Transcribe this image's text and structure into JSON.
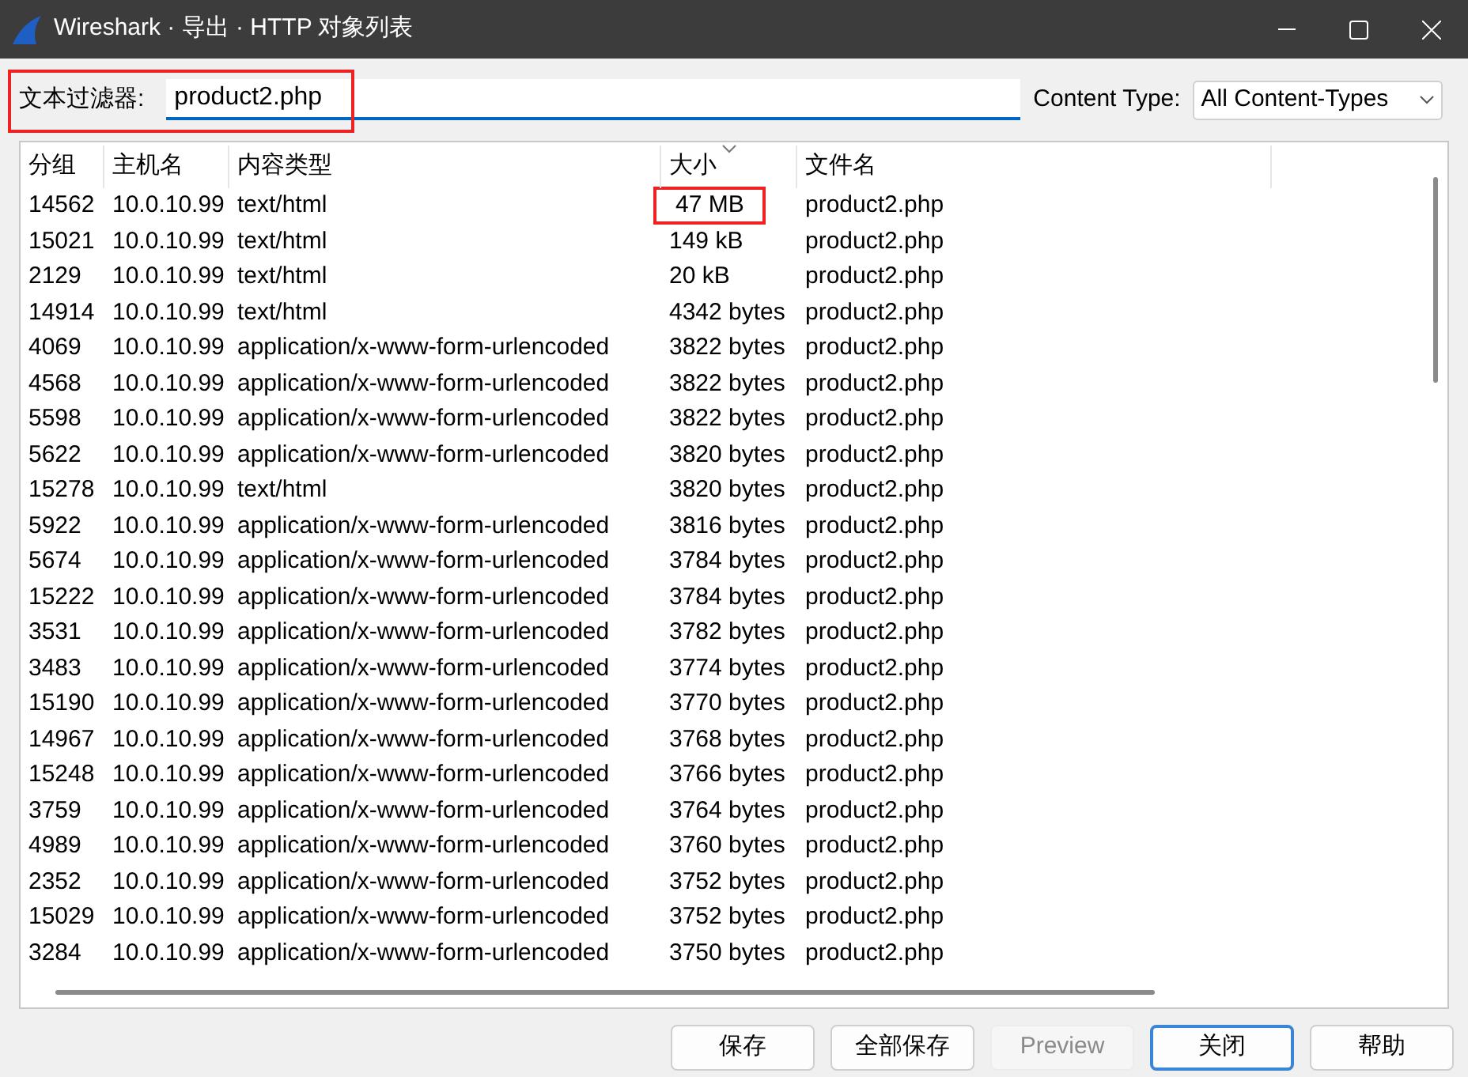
{
  "window": {
    "title": "Wireshark · 导出 · HTTP 对象列表"
  },
  "filter": {
    "label": "文本过滤器:",
    "value": "product2.php",
    "highlighted": true
  },
  "content_type": {
    "label": "Content Type:",
    "value": "All Content-Types"
  },
  "table": {
    "columns": [
      {
        "label": "分组",
        "sorted": false
      },
      {
        "label": "主机名",
        "sorted": false
      },
      {
        "label": "内容类型",
        "sorted": false
      },
      {
        "label": "大小",
        "sorted": true
      },
      {
        "label": "文件名",
        "sorted": false
      }
    ],
    "rows": [
      {
        "cells": [
          "14562",
          "10.0.10.99",
          "text/html",
          "47 MB",
          "product2.php"
        ],
        "size_highlighted": true
      },
      {
        "cells": [
          "15021",
          "10.0.10.99",
          "text/html",
          "149 kB",
          "product2.php"
        ],
        "size_highlighted": false
      },
      {
        "cells": [
          "2129",
          "10.0.10.99",
          "text/html",
          "20 kB",
          "product2.php"
        ],
        "size_highlighted": false
      },
      {
        "cells": [
          "14914",
          "10.0.10.99",
          "text/html",
          "4342 bytes",
          "product2.php"
        ],
        "size_highlighted": false
      },
      {
        "cells": [
          "4069",
          "10.0.10.99",
          "application/x-www-form-urlencoded",
          "3822 bytes",
          "product2.php"
        ],
        "size_highlighted": false
      },
      {
        "cells": [
          "4568",
          "10.0.10.99",
          "application/x-www-form-urlencoded",
          "3822 bytes",
          "product2.php"
        ],
        "size_highlighted": false
      },
      {
        "cells": [
          "5598",
          "10.0.10.99",
          "application/x-www-form-urlencoded",
          "3822 bytes",
          "product2.php"
        ],
        "size_highlighted": false
      },
      {
        "cells": [
          "5622",
          "10.0.10.99",
          "application/x-www-form-urlencoded",
          "3820 bytes",
          "product2.php"
        ],
        "size_highlighted": false
      },
      {
        "cells": [
          "15278",
          "10.0.10.99",
          "text/html",
          "3820 bytes",
          "product2.php"
        ],
        "size_highlighted": false
      },
      {
        "cells": [
          "5922",
          "10.0.10.99",
          "application/x-www-form-urlencoded",
          "3816 bytes",
          "product2.php"
        ],
        "size_highlighted": false
      },
      {
        "cells": [
          "5674",
          "10.0.10.99",
          "application/x-www-form-urlencoded",
          "3784 bytes",
          "product2.php"
        ],
        "size_highlighted": false
      },
      {
        "cells": [
          "15222",
          "10.0.10.99",
          "application/x-www-form-urlencoded",
          "3784 bytes",
          "product2.php"
        ],
        "size_highlighted": false
      },
      {
        "cells": [
          "3531",
          "10.0.10.99",
          "application/x-www-form-urlencoded",
          "3782 bytes",
          "product2.php"
        ],
        "size_highlighted": false
      },
      {
        "cells": [
          "3483",
          "10.0.10.99",
          "application/x-www-form-urlencoded",
          "3774 bytes",
          "product2.php"
        ],
        "size_highlighted": false
      },
      {
        "cells": [
          "15190",
          "10.0.10.99",
          "application/x-www-form-urlencoded",
          "3770 bytes",
          "product2.php"
        ],
        "size_highlighted": false
      },
      {
        "cells": [
          "14967",
          "10.0.10.99",
          "application/x-www-form-urlencoded",
          "3768 bytes",
          "product2.php"
        ],
        "size_highlighted": false
      },
      {
        "cells": [
          "15248",
          "10.0.10.99",
          "application/x-www-form-urlencoded",
          "3766 bytes",
          "product2.php"
        ],
        "size_highlighted": false
      },
      {
        "cells": [
          "3759",
          "10.0.10.99",
          "application/x-www-form-urlencoded",
          "3764 bytes",
          "product2.php"
        ],
        "size_highlighted": false
      },
      {
        "cells": [
          "4989",
          "10.0.10.99",
          "application/x-www-form-urlencoded",
          "3760 bytes",
          "product2.php"
        ],
        "size_highlighted": false
      },
      {
        "cells": [
          "2352",
          "10.0.10.99",
          "application/x-www-form-urlencoded",
          "3752 bytes",
          "product2.php"
        ],
        "size_highlighted": false
      },
      {
        "cells": [
          "15029",
          "10.0.10.99",
          "application/x-www-form-urlencoded",
          "3752 bytes",
          "product2.php"
        ],
        "size_highlighted": false
      },
      {
        "cells": [
          "3284",
          "10.0.10.99",
          "application/x-www-form-urlencoded",
          "3750 bytes",
          "product2.php"
        ],
        "size_highlighted": false
      }
    ]
  },
  "buttons": [
    {
      "label": "保存",
      "disabled": false,
      "default": false
    },
    {
      "label": "全部保存",
      "disabled": false,
      "default": false
    },
    {
      "label": "Preview",
      "disabled": true,
      "default": false
    },
    {
      "label": "关闭",
      "disabled": false,
      "default": true
    },
    {
      "label": "帮助",
      "disabled": false,
      "default": false
    }
  ]
}
